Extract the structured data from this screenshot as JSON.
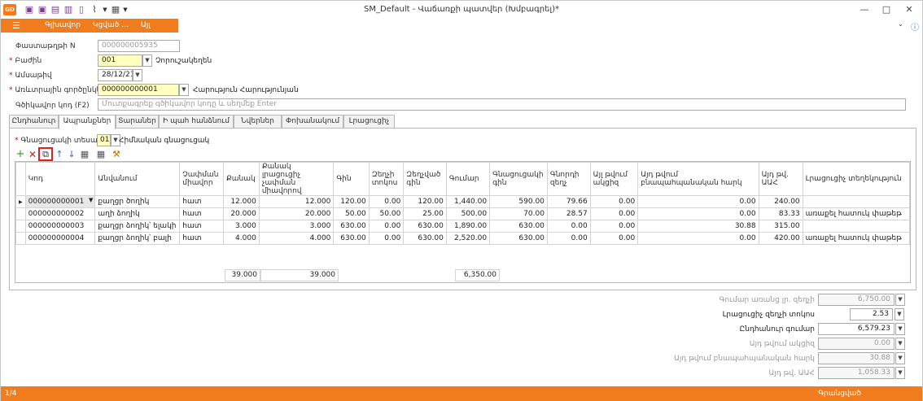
{
  "app": {
    "logo": "GD",
    "title": "SM_Default - Վաճառքի պատվեր (Խմբագրել)*"
  },
  "menu": {
    "items": [
      "Գլխավոր",
      "Կցված ...",
      "Այլ"
    ]
  },
  "form": {
    "doc_no_label": "Փաստաթղթի N",
    "doc_no_value": "000000005935",
    "division_label": "Բաժին",
    "division_value": "001",
    "division_name": "Չորուշակեղեն",
    "date_label": "Ամսաթիվ",
    "date_value": "28/12/21",
    "partner_label": "Առևտրային գործընկեր",
    "partner_value": "000000000001",
    "partner_name": "Հարություն Հարությունյան",
    "barcode_label": "Գծիկավոր կոդ (F2)",
    "barcode_placeholder": "Մուտքագրեք գծիկավոր կոդը և սեղմեք Enter"
  },
  "tabs": [
    "Ընդհանուր",
    "Ապրանքներ",
    "Տարաներ",
    "Ի պահ հանձնում",
    "Նվերներ",
    "Փոխանակում",
    "Լրացուցիչ"
  ],
  "price_type": {
    "label": "Գնացուցակի տեսակ",
    "value": "01",
    "name": "Հիմնական գնացուցակ"
  },
  "grid": {
    "columns": [
      "Կոդ",
      "Անվանում",
      "Չափման միավոր",
      "Քանակ",
      "Քանակ լրացուցիչ չափման միավորով",
      "Գին",
      "Զեղչի տոկոս",
      "Զեղչված գին",
      "Գումար",
      "Գնացուցակի գին",
      "Գնորդի զեղչ",
      "Այլ թվում ակցիզ",
      "Այդ թվում բնապահպանական հարկ",
      "Այդ թվ. ԱԱՀ",
      "Լրացուցիչ տեղեկություն"
    ],
    "rows": [
      {
        "code": "000000000001",
        "name": "քաղցր ծողիկ",
        "unit": "հատ",
        "qty": "12.000",
        "qty2": "12.000",
        "price": "120.00",
        "disc": "0.00",
        "dprice": "120.00",
        "amount": "1,440.00",
        "lprice": "590.00",
        "bdisc": "79.66",
        "excise": "0.00",
        "eco": "0.00",
        "vat": "240.00",
        "note": ""
      },
      {
        "code": "000000000002",
        "name": "աղի ձողիկ",
        "unit": "հատ",
        "qty": "20.000",
        "qty2": "20.000",
        "price": "50.00",
        "disc": "50.00",
        "dprice": "25.00",
        "amount": "500.00",
        "lprice": "70.00",
        "bdisc": "28.57",
        "excise": "0.00",
        "eco": "0.00",
        "vat": "83.33",
        "note": "առաքել հատուկ փաթեթ"
      },
      {
        "code": "000000000003",
        "name": "քաղցր ձողիկ՝ ելակի",
        "unit": "հատ",
        "qty": "3.000",
        "qty2": "3.000",
        "price": "630.00",
        "disc": "0.00",
        "dprice": "630.00",
        "amount": "1,890.00",
        "lprice": "630.00",
        "bdisc": "0.00",
        "excise": "0.00",
        "eco": "30.88",
        "vat": "315.00",
        "note": ""
      },
      {
        "code": "000000000004",
        "name": "քաղցր ձողիկ՝ բալի",
        "unit": "հատ",
        "qty": "4.000",
        "qty2": "4.000",
        "price": "630.00",
        "disc": "0.00",
        "dprice": "630.00",
        "amount": "2,520.00",
        "lprice": "630.00",
        "bdisc": "0.00",
        "excise": "0.00",
        "eco": "0.00",
        "vat": "420.00",
        "note": "առաքել հատուկ փաթեթ"
      }
    ],
    "footer": {
      "qty": "39.000",
      "qty2": "39.000",
      "amount": "6,350.00"
    }
  },
  "totals": {
    "sum_no_disc_label": "Գումար առանց լր. զեղչի",
    "sum_no_disc": "6,750.00",
    "extra_disc_label": "Լրացուցիչ զեղչի տոկոս",
    "extra_disc": "2.53",
    "total_label": "Ընդհանուր գումար",
    "total": "6,579.23",
    "excise_label": "Այդ թվում ակցիզ",
    "excise": "0.00",
    "eco_label": "Այդ թվում բնապահպանական հարկ",
    "eco": "30.88",
    "vat_label": "Այդ թվ. ԱԱՀ",
    "vat": "1,058.33"
  },
  "status": {
    "position": "1/4",
    "state": "Գրանցված"
  },
  "colors": {
    "accent": "#f07c1e",
    "required": "#dd0000",
    "highlight": "#ffffc0"
  }
}
